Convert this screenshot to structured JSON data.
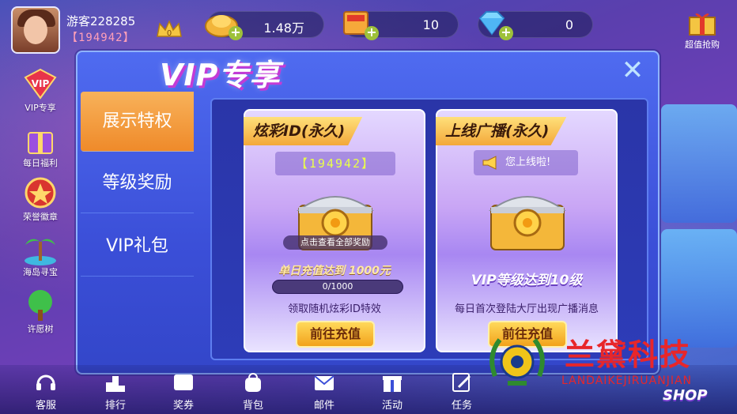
{
  "user": {
    "name": "游客228285",
    "id": "【194942】"
  },
  "resources": [
    {
      "name": "gold-coins",
      "value": "1.48万"
    },
    {
      "name": "tickets",
      "value": "10"
    },
    {
      "name": "diamonds",
      "value": "0"
    }
  ],
  "top_shop_label": "超值抢购",
  "side_icons": [
    {
      "label": "VIP专享"
    },
    {
      "label": "每日福利"
    },
    {
      "label": "荣誉徽章"
    },
    {
      "label": "海岛寻宝"
    },
    {
      "label": "许愿树"
    }
  ],
  "modal": {
    "title": "VIP专享",
    "close_symbol": "✕",
    "tabs": [
      {
        "label": "展示特权",
        "active": true
      },
      {
        "label": "等级奖励",
        "active": false
      },
      {
        "label": "VIP礼包",
        "active": false
      }
    ],
    "cards": [
      {
        "ribbon": "炫彩ID(永久)",
        "id_display": "【194942】",
        "view_all": "点击查看全部奖励",
        "condition": "单日充值达到 1000元",
        "progress_text": "0/1000",
        "progress": 0,
        "description": "领取随机炫彩ID特效",
        "button": "前往充值"
      },
      {
        "ribbon": "上线广播(永久)",
        "online_text": "您上线啦!",
        "condition": "VIP等级达到10级",
        "description": "每日首次登陆大厅出现广播消息",
        "button": "前往充值"
      }
    ]
  },
  "bottom_nav": [
    {
      "label": "客服"
    },
    {
      "label": "排行"
    },
    {
      "label": "奖券"
    },
    {
      "label": "背包"
    },
    {
      "label": "邮件"
    },
    {
      "label": "活动"
    },
    {
      "label": "任务"
    }
  ],
  "bottom_shop_label": "SHOP",
  "watermark": {
    "cn": "兰黛科技",
    "en": "LANDAIKEJIRUANJIAN"
  },
  "colors": {
    "accent_tab": "#ef8a2a",
    "modal_bg": "#3b4fd8",
    "button": "#f2a21c",
    "watermark": "#e8262a"
  }
}
